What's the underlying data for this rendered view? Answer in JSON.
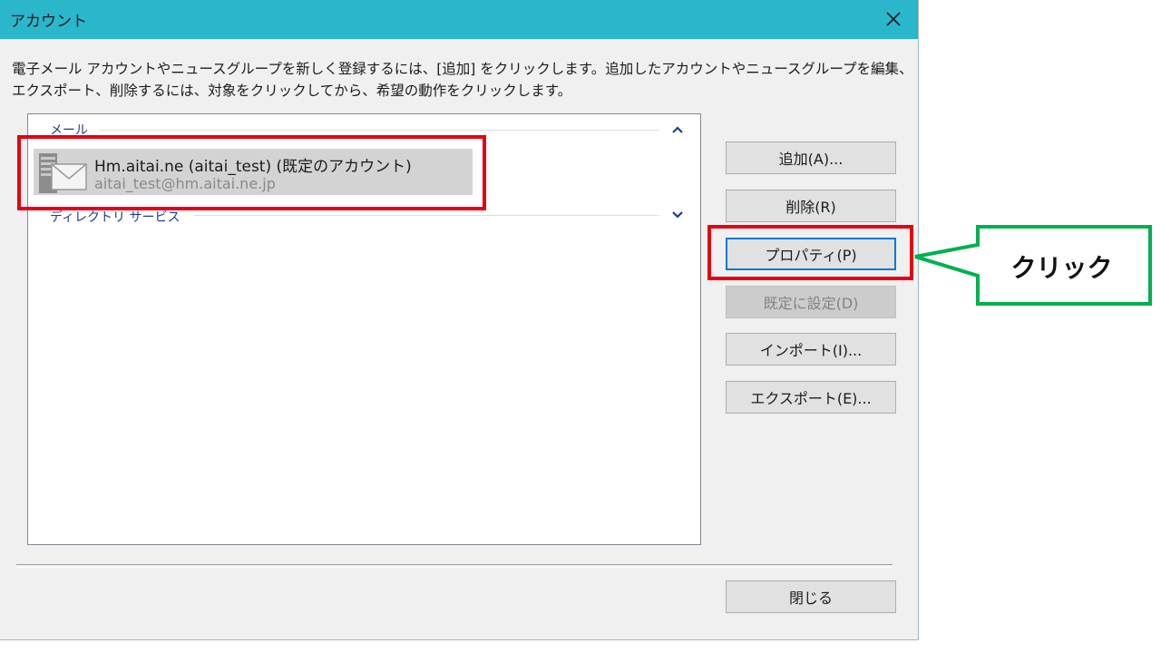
{
  "window": {
    "title": "アカウント",
    "close_glyph": "✕"
  },
  "description": "電子メール アカウントやニュースグループを新しく登録するには、[追加] をクリックします。追加したアカウントやニュースグループを編集、エクスポート、削除するには、対象をクリックしてから、希望の動作をクリックします。",
  "list": {
    "groups": [
      {
        "label": "メール",
        "chevron": "up-chevron-icon",
        "items": [
          {
            "name": "Hm.aitai.ne (aitai_test) (既定のアカウント)",
            "email": "aitai_test@hm.aitai.ne.jp",
            "icon": "mail-account-icon",
            "selected": true
          }
        ]
      },
      {
        "label": "ディレクトリ サービス",
        "chevron": "down-chevron-icon",
        "items": []
      }
    ]
  },
  "buttons": {
    "add": "追加(A)...",
    "remove": "削除(R)",
    "properties": "プロパティ(P)",
    "set_default": "既定に設定(D)",
    "import": "インポート(I)...",
    "export": "エクスポート(E)...",
    "close": "閉じる"
  },
  "annotation": {
    "callout_text": "クリック",
    "highlight_color": "#e60012",
    "callout_color": "#00b050"
  },
  "colors": {
    "titlebar": "#2ab6cb",
    "group_header_text": "#1e3d8f",
    "selection": "#d3d3d3",
    "focus_border": "#0078d7"
  }
}
